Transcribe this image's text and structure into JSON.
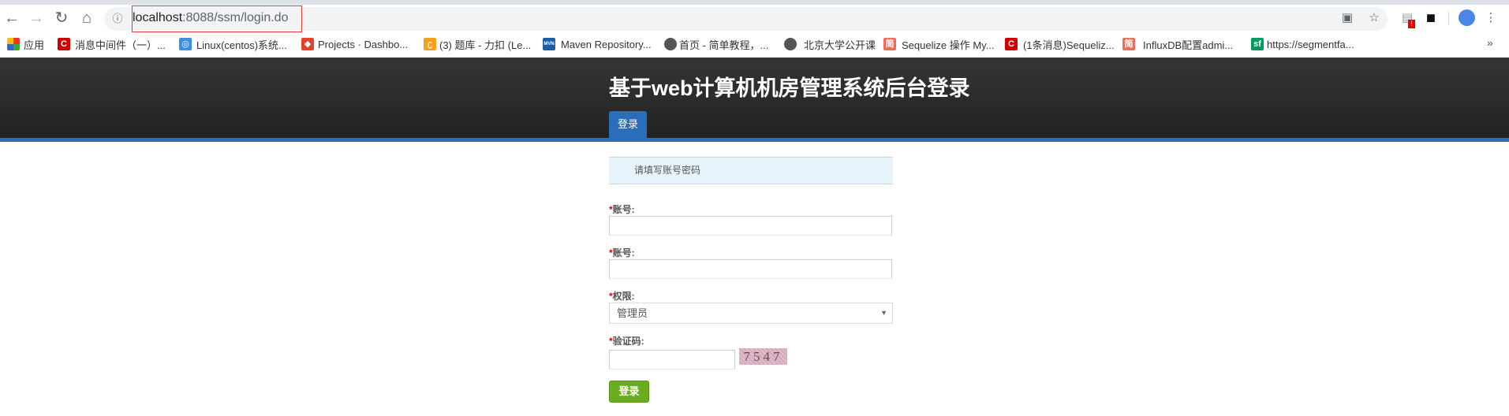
{
  "browser": {
    "url_host": "localhost",
    "url_rest": ":8088/ssm/login.do",
    "bookmarks": [
      {
        "label": "应用",
        "icon": "apps-grid-icon"
      },
      {
        "label": "消息中间件（一）...",
        "icon": "csdn-icon",
        "glyph": "C",
        "color": "#c00"
      },
      {
        "label": "Linux(centos)系统...",
        "icon": "site-icon",
        "glyph": "◎",
        "color": "#3b8ee0"
      },
      {
        "label": "Projects · Dashbo...",
        "icon": "gitlab-icon",
        "glyph": "◆",
        "color": "#e2432a"
      },
      {
        "label": "(3) 题库 - 力扣 (Le...",
        "icon": "leetcode-icon",
        "glyph": "ʗ",
        "color": "#f89f1b"
      },
      {
        "label": "Maven Repository...",
        "icon": "maven-icon",
        "glyph": "MVN",
        "color": "#1c5ea8"
      },
      {
        "label": "首页 - 简单教程，...",
        "icon": "globe-icon",
        "glyph": "●",
        "color": "#555"
      },
      {
        "label": "北京大学公开课",
        "icon": "globe-icon",
        "glyph": "●",
        "color": "#555"
      },
      {
        "label": "Sequelize 操作 My...",
        "icon": "jianshu-icon",
        "glyph": "简",
        "color": "#ea6f5a"
      },
      {
        "label": "(1条消息)Sequeliz...",
        "icon": "csdn-icon",
        "glyph": "C",
        "color": "#c00"
      },
      {
        "label": "InfluxDB配置admi...",
        "icon": "jianshu-icon",
        "glyph": "简",
        "color": "#ea6f5a"
      },
      {
        "label": "https://segmentfa...",
        "icon": "segmentfault-icon",
        "glyph": "sf",
        "color": "#009a61"
      }
    ],
    "more": "»"
  },
  "header": {
    "title": "基于web计算机机房管理系统后台登录",
    "tab": "登录"
  },
  "form": {
    "alert": "请填写账号密码",
    "required_mark": "*",
    "field1_label": "账号:",
    "field2_label": "账号:",
    "role_label": "权限:",
    "role_value": "管理员",
    "captcha_label": "验证码:",
    "captcha_text": "7547",
    "submit": "登录"
  }
}
